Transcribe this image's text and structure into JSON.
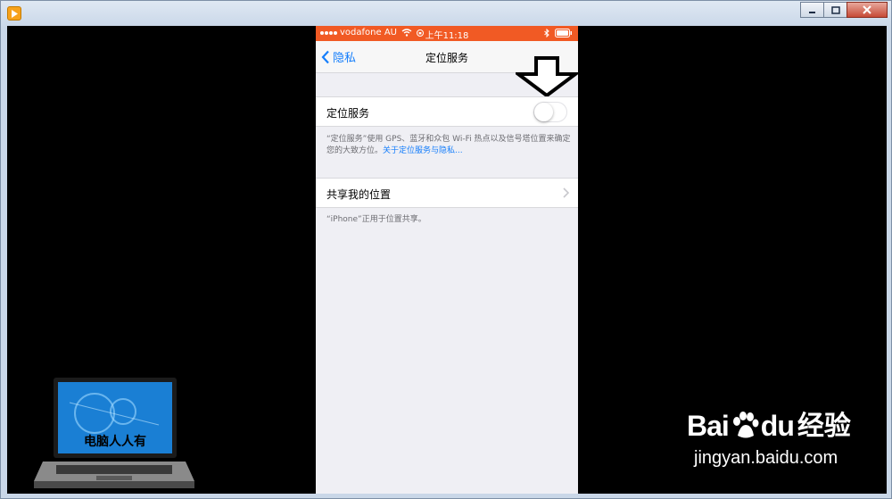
{
  "window": {
    "controls": {
      "minimize": "minimize",
      "maximize": "maximize",
      "close": "close"
    }
  },
  "statusbar": {
    "carrier": "vodafone AU",
    "time": "上午11:18"
  },
  "navbar": {
    "back_label": "隐私",
    "title": "定位服务"
  },
  "location_services": {
    "label": "定位服务",
    "enabled": false,
    "description": "“定位服务”使用 GPS、蓝牙和众包 Wi-Fi 热点以及信号塔位置来确定您的大致方位。",
    "link": "关于定位服务与隐私..."
  },
  "share_location": {
    "label": "共享我的位置",
    "footer": "“iPhone”正用于位置共享。"
  },
  "watermarks": {
    "laptop_text": "电脑人人有",
    "baidu_logo": "Bai",
    "baidu_logo_end": "du",
    "baidu_cn": "经验",
    "baidu_url": "jingyan.baidu.com"
  },
  "colors": {
    "statusbar": "#f15a24",
    "ios_blue": "#157efb",
    "ios_background": "#efeff4"
  }
}
